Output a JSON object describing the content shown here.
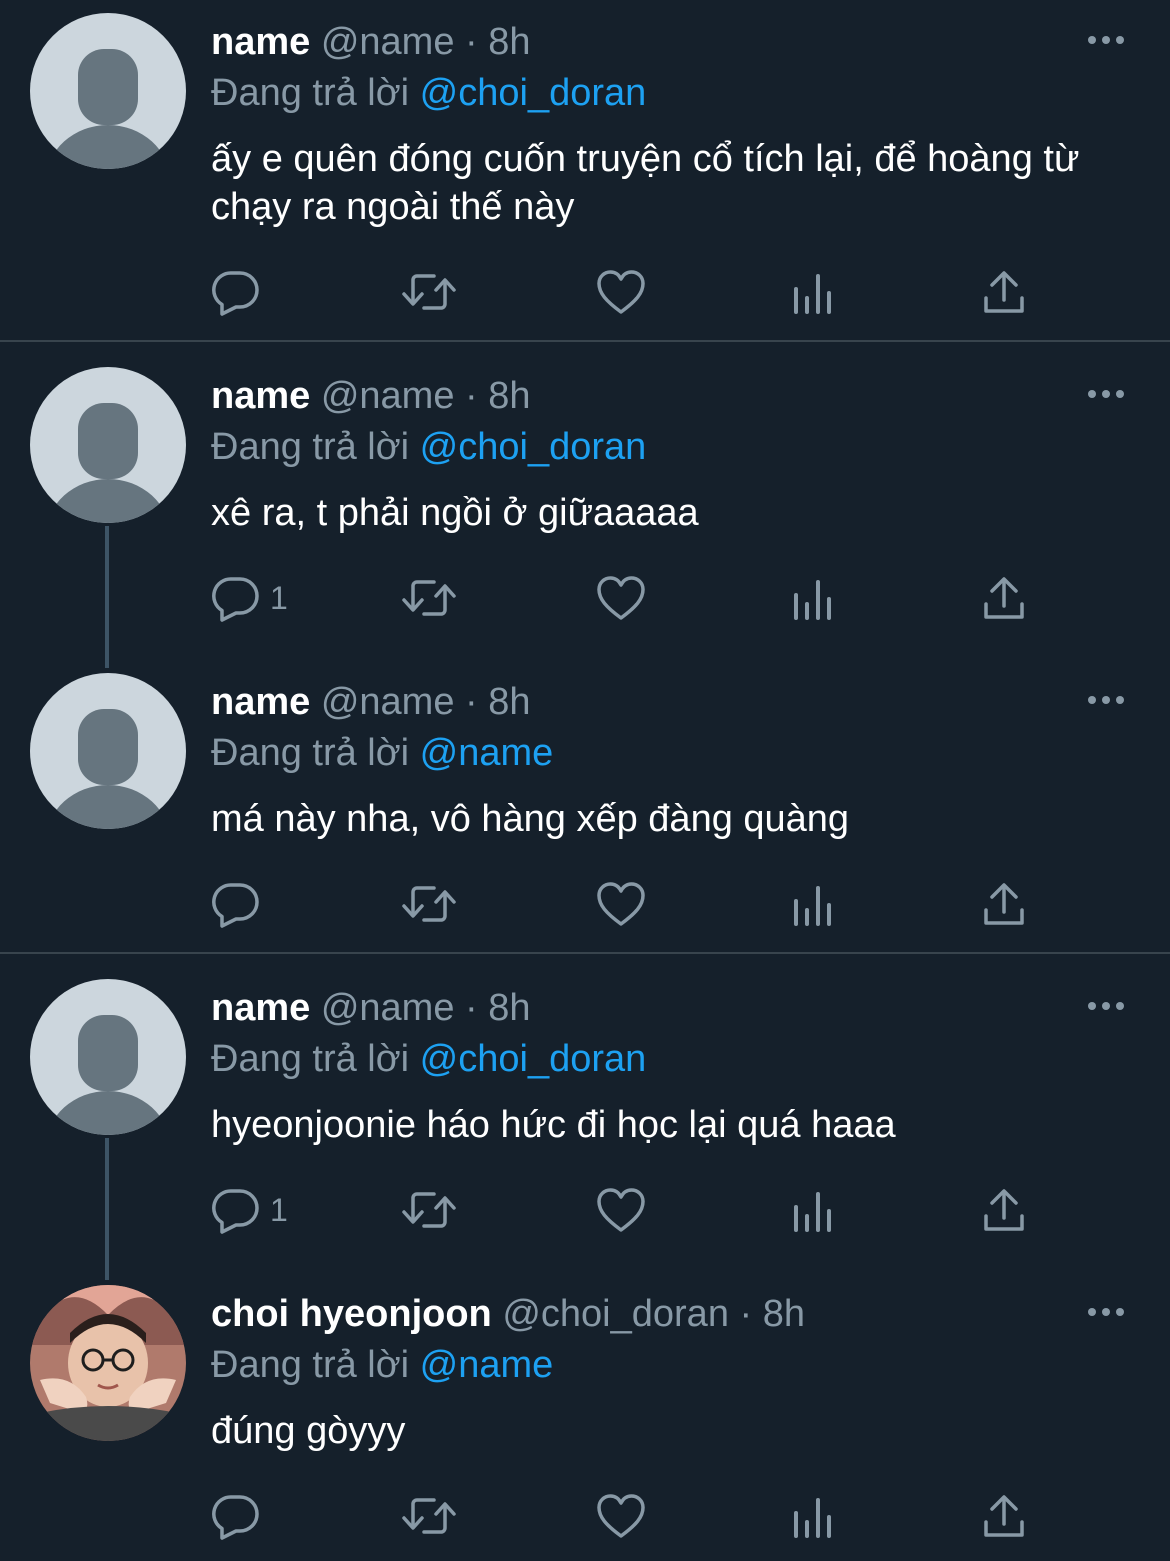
{
  "tweets": [
    {
      "name": "name",
      "handle": "@name",
      "separator": "·",
      "time": "8h",
      "reply_prefix": "Đang trả lời",
      "reply_to": "@choi_doran",
      "text": "ấy e quên đóng cuốn truyện cổ tích lại, để hoàng từ chạy ra ngoài thế này",
      "reply_count": "",
      "avatar": "default-avatar"
    },
    {
      "name": "name",
      "handle": "@name",
      "separator": "·",
      "time": "8h",
      "reply_prefix": "Đang trả lời",
      "reply_to": "@choi_doran",
      "text": "xê ra, t phải ngồi ở giữaaaaa",
      "reply_count": "1",
      "avatar": "default-avatar"
    },
    {
      "name": "name",
      "handle": "@name",
      "separator": "·",
      "time": "8h",
      "reply_prefix": "Đang trả lời",
      "reply_to": "@name",
      "text": "má này nha, vô hàng xếp đàng quàng",
      "reply_count": "",
      "avatar": "default-avatar"
    },
    {
      "name": "name",
      "handle": "@name",
      "separator": "·",
      "time": "8h",
      "reply_prefix": "Đang trả lời",
      "reply_to": "@choi_doran",
      "text": "hyeonjoonie háo hức đi học lại quá haaa",
      "reply_count": "1",
      "avatar": "default-avatar"
    },
    {
      "name": "choi hyeonjoon",
      "handle": "@choi_doran",
      "separator": "·",
      "time": "8h",
      "reply_prefix": "Đang trả lời",
      "reply_to": "@name",
      "text": "đúng gòyyy",
      "reply_count": "",
      "avatar": "photo-avatar"
    }
  ],
  "colors": {
    "background": "#15202b",
    "text": "#ffffff",
    "secondary": "#8899a6",
    "accent": "#1da1f2",
    "divider": "#38444d",
    "thread_line": "#3d5466"
  },
  "icons": [
    "reply-icon",
    "retweet-icon",
    "like-icon",
    "analytics-icon",
    "share-icon",
    "more-icon"
  ]
}
